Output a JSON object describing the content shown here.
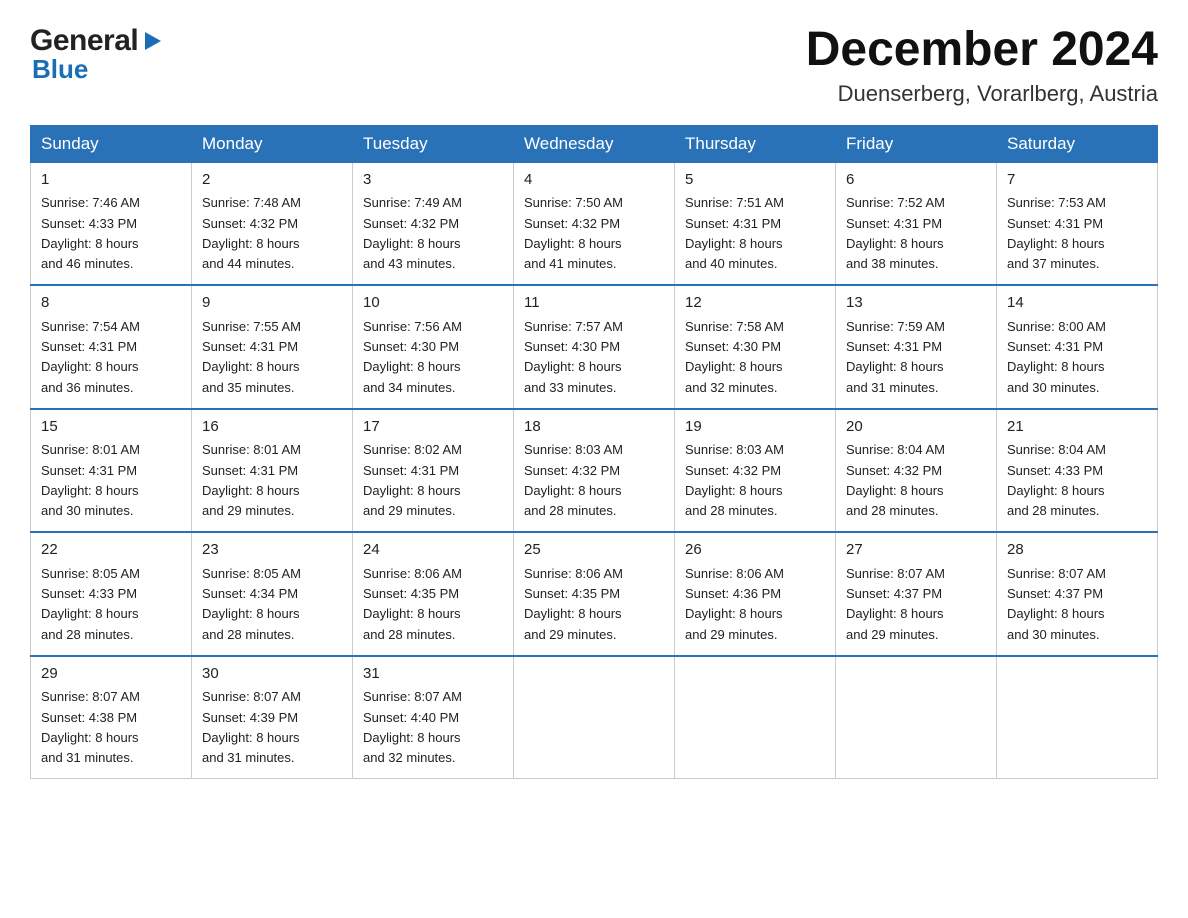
{
  "logo": {
    "line1": "General",
    "arrow": "▶",
    "line2": "Blue"
  },
  "header": {
    "month": "December 2024",
    "location": "Duenserberg, Vorarlberg, Austria"
  },
  "columns": [
    "Sunday",
    "Monday",
    "Tuesday",
    "Wednesday",
    "Thursday",
    "Friday",
    "Saturday"
  ],
  "weeks": [
    [
      {
        "day": "1",
        "sunrise": "7:46 AM",
        "sunset": "4:33 PM",
        "daylight": "8 hours and 46 minutes."
      },
      {
        "day": "2",
        "sunrise": "7:48 AM",
        "sunset": "4:32 PM",
        "daylight": "8 hours and 44 minutes."
      },
      {
        "day": "3",
        "sunrise": "7:49 AM",
        "sunset": "4:32 PM",
        "daylight": "8 hours and 43 minutes."
      },
      {
        "day": "4",
        "sunrise": "7:50 AM",
        "sunset": "4:32 PM",
        "daylight": "8 hours and 41 minutes."
      },
      {
        "day": "5",
        "sunrise": "7:51 AM",
        "sunset": "4:31 PM",
        "daylight": "8 hours and 40 minutes."
      },
      {
        "day": "6",
        "sunrise": "7:52 AM",
        "sunset": "4:31 PM",
        "daylight": "8 hours and 38 minutes."
      },
      {
        "day": "7",
        "sunrise": "7:53 AM",
        "sunset": "4:31 PM",
        "daylight": "8 hours and 37 minutes."
      }
    ],
    [
      {
        "day": "8",
        "sunrise": "7:54 AM",
        "sunset": "4:31 PM",
        "daylight": "8 hours and 36 minutes."
      },
      {
        "day": "9",
        "sunrise": "7:55 AM",
        "sunset": "4:31 PM",
        "daylight": "8 hours and 35 minutes."
      },
      {
        "day": "10",
        "sunrise": "7:56 AM",
        "sunset": "4:30 PM",
        "daylight": "8 hours and 34 minutes."
      },
      {
        "day": "11",
        "sunrise": "7:57 AM",
        "sunset": "4:30 PM",
        "daylight": "8 hours and 33 minutes."
      },
      {
        "day": "12",
        "sunrise": "7:58 AM",
        "sunset": "4:30 PM",
        "daylight": "8 hours and 32 minutes."
      },
      {
        "day": "13",
        "sunrise": "7:59 AM",
        "sunset": "4:31 PM",
        "daylight": "8 hours and 31 minutes."
      },
      {
        "day": "14",
        "sunrise": "8:00 AM",
        "sunset": "4:31 PM",
        "daylight": "8 hours and 30 minutes."
      }
    ],
    [
      {
        "day": "15",
        "sunrise": "8:01 AM",
        "sunset": "4:31 PM",
        "daylight": "8 hours and 30 minutes."
      },
      {
        "day": "16",
        "sunrise": "8:01 AM",
        "sunset": "4:31 PM",
        "daylight": "8 hours and 29 minutes."
      },
      {
        "day": "17",
        "sunrise": "8:02 AM",
        "sunset": "4:31 PM",
        "daylight": "8 hours and 29 minutes."
      },
      {
        "day": "18",
        "sunrise": "8:03 AM",
        "sunset": "4:32 PM",
        "daylight": "8 hours and 28 minutes."
      },
      {
        "day": "19",
        "sunrise": "8:03 AM",
        "sunset": "4:32 PM",
        "daylight": "8 hours and 28 minutes."
      },
      {
        "day": "20",
        "sunrise": "8:04 AM",
        "sunset": "4:32 PM",
        "daylight": "8 hours and 28 minutes."
      },
      {
        "day": "21",
        "sunrise": "8:04 AM",
        "sunset": "4:33 PM",
        "daylight": "8 hours and 28 minutes."
      }
    ],
    [
      {
        "day": "22",
        "sunrise": "8:05 AM",
        "sunset": "4:33 PM",
        "daylight": "8 hours and 28 minutes."
      },
      {
        "day": "23",
        "sunrise": "8:05 AM",
        "sunset": "4:34 PM",
        "daylight": "8 hours and 28 minutes."
      },
      {
        "day": "24",
        "sunrise": "8:06 AM",
        "sunset": "4:35 PM",
        "daylight": "8 hours and 28 minutes."
      },
      {
        "day": "25",
        "sunrise": "8:06 AM",
        "sunset": "4:35 PM",
        "daylight": "8 hours and 29 minutes."
      },
      {
        "day": "26",
        "sunrise": "8:06 AM",
        "sunset": "4:36 PM",
        "daylight": "8 hours and 29 minutes."
      },
      {
        "day": "27",
        "sunrise": "8:07 AM",
        "sunset": "4:37 PM",
        "daylight": "8 hours and 29 minutes."
      },
      {
        "day": "28",
        "sunrise": "8:07 AM",
        "sunset": "4:37 PM",
        "daylight": "8 hours and 30 minutes."
      }
    ],
    [
      {
        "day": "29",
        "sunrise": "8:07 AM",
        "sunset": "4:38 PM",
        "daylight": "8 hours and 31 minutes."
      },
      {
        "day": "30",
        "sunrise": "8:07 AM",
        "sunset": "4:39 PM",
        "daylight": "8 hours and 31 minutes."
      },
      {
        "day": "31",
        "sunrise": "8:07 AM",
        "sunset": "4:40 PM",
        "daylight": "8 hours and 32 minutes."
      },
      null,
      null,
      null,
      null
    ]
  ]
}
